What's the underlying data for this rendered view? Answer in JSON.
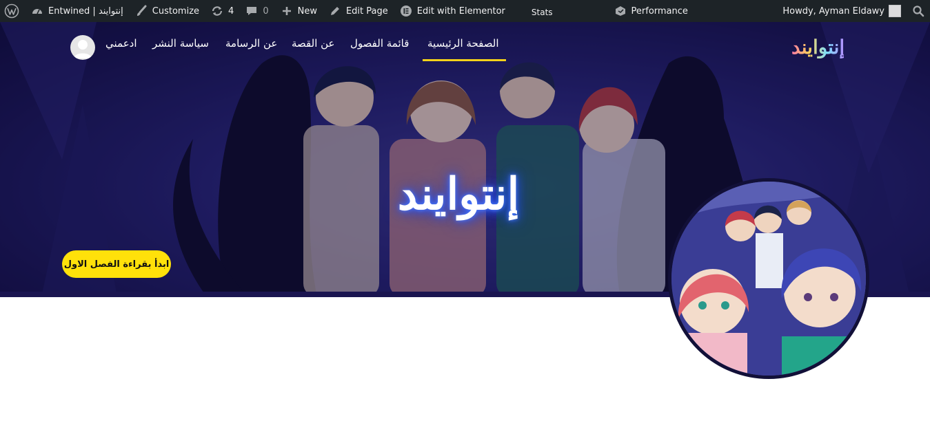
{
  "adminbar": {
    "site_name": "Entwined | إنتوايند",
    "customize": "Customize",
    "updates_count": "4",
    "comments_count": "0",
    "new": "New",
    "edit_page": "Edit Page",
    "edit_elementor": "Edit with Elementor",
    "stats": "Stats",
    "performance": "Performance",
    "howdy": "Howdy, Ayman Eldawy"
  },
  "nav": {
    "items": [
      {
        "label": "الصفحة الرئيسية",
        "active": true
      },
      {
        "label": "قائمة الفصول"
      },
      {
        "label": "عن القصة"
      },
      {
        "label": "عن الرسامة"
      },
      {
        "label": "سياسة النشر"
      },
      {
        "label": "ادعمني"
      }
    ],
    "active_color": "#f5d21a"
  },
  "logo": "إنتوايند",
  "hero": {
    "title": "إنتوايند",
    "cta_label": "ابدأ بقراءة الفصل الاول",
    "cta_color": "#ffe10a"
  },
  "colors": {
    "adminbar_bg": "#1d2327",
    "hero_bg": "#252270"
  }
}
